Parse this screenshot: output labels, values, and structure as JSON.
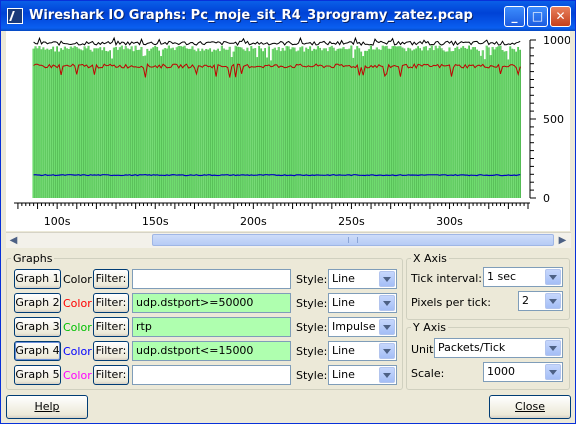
{
  "window": {
    "title": "Wireshark IO Graphs: Pc_moje_sit_R4_3programy_zatez.pcap",
    "minimize": "_",
    "maximize": "□",
    "close": "✕"
  },
  "chart_data": {
    "type": "line",
    "x_ticks": [
      "100s",
      "150s",
      "200s",
      "250s",
      "300s"
    ],
    "y_ticks": [
      "1000",
      "500",
      "0"
    ],
    "ylim": [
      0,
      1000
    ],
    "xlim": [
      78,
      340
    ],
    "series": [
      {
        "style": "Line",
        "color": "#000000",
        "values_approx": {
          "from": 88,
          "to": 336,
          "level": 980
        }
      },
      {
        "style": "Line",
        "color": "#c00000",
        "values_approx": {
          "from": 88,
          "to": 336,
          "level": 835
        }
      },
      {
        "style": "Impulse",
        "color": "#00c000",
        "values_approx": {
          "from": 88,
          "to": 336,
          "level": 965
        }
      },
      {
        "style": "Line",
        "color": "#0000c0",
        "values_approx": {
          "from": 88,
          "to": 336,
          "level": 145
        }
      }
    ]
  },
  "graphs": {
    "legend": "Graphs",
    "color_label": "Color",
    "filter_label": "Filter:",
    "style_label": "Style:",
    "rows": [
      {
        "button": "Graph 1",
        "color_text": "Color",
        "color": "#000000",
        "filter": "",
        "style": "Line"
      },
      {
        "button": "Graph 2",
        "color_text": "Color",
        "color": "#ff0000",
        "filter": "udp.dstport>=50000",
        "style": "Line"
      },
      {
        "button": "Graph 3",
        "color_text": "Color",
        "color": "#00c000",
        "filter": "rtp",
        "style": "Impulse"
      },
      {
        "button": "Graph 4",
        "color_text": "Color",
        "color": "#0000ff",
        "filter": "udp.dstport<=15000",
        "style": "Line"
      },
      {
        "button": "Graph 5",
        "color_text": "Color",
        "color": "#ff00ff",
        "filter": "",
        "style": "Line"
      }
    ]
  },
  "x_axis": {
    "legend": "X Axis",
    "tick_interval_label": "Tick interval:",
    "tick_interval_value": "1 sec",
    "pixels_per_tick_label": "Pixels per tick:",
    "pixels_per_tick_value": "2"
  },
  "y_axis": {
    "legend": "Y Axis",
    "unit_label": "Unit:",
    "unit_value": "Packets/Tick",
    "scale_label": "Scale:",
    "scale_value": "1000"
  },
  "buttons": {
    "help": "Help",
    "close": "Close"
  },
  "icons": {
    "app": "wireshark-icon",
    "scroll_left": "◀",
    "scroll_right": "▶"
  }
}
